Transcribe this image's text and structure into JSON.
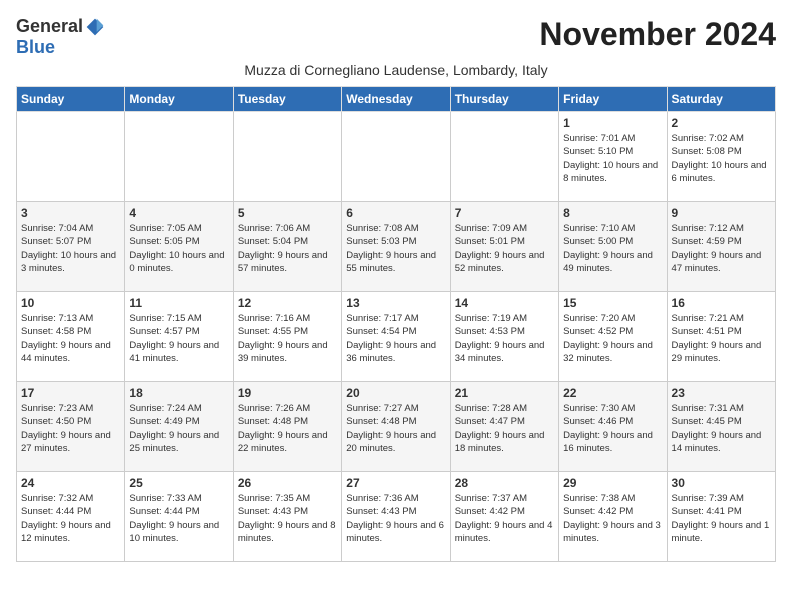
{
  "logo": {
    "general": "General",
    "blue": "Blue"
  },
  "title": "November 2024",
  "subtitle": "Muzza di Cornegliano Laudense, Lombardy, Italy",
  "days_of_week": [
    "Sunday",
    "Monday",
    "Tuesday",
    "Wednesday",
    "Thursday",
    "Friday",
    "Saturday"
  ],
  "weeks": [
    [
      {
        "day": "",
        "info": ""
      },
      {
        "day": "",
        "info": ""
      },
      {
        "day": "",
        "info": ""
      },
      {
        "day": "",
        "info": ""
      },
      {
        "day": "",
        "info": ""
      },
      {
        "day": "1",
        "info": "Sunrise: 7:01 AM\nSunset: 5:10 PM\nDaylight: 10 hours and 8 minutes."
      },
      {
        "day": "2",
        "info": "Sunrise: 7:02 AM\nSunset: 5:08 PM\nDaylight: 10 hours and 6 minutes."
      }
    ],
    [
      {
        "day": "3",
        "info": "Sunrise: 7:04 AM\nSunset: 5:07 PM\nDaylight: 10 hours and 3 minutes."
      },
      {
        "day": "4",
        "info": "Sunrise: 7:05 AM\nSunset: 5:05 PM\nDaylight: 10 hours and 0 minutes."
      },
      {
        "day": "5",
        "info": "Sunrise: 7:06 AM\nSunset: 5:04 PM\nDaylight: 9 hours and 57 minutes."
      },
      {
        "day": "6",
        "info": "Sunrise: 7:08 AM\nSunset: 5:03 PM\nDaylight: 9 hours and 55 minutes."
      },
      {
        "day": "7",
        "info": "Sunrise: 7:09 AM\nSunset: 5:01 PM\nDaylight: 9 hours and 52 minutes."
      },
      {
        "day": "8",
        "info": "Sunrise: 7:10 AM\nSunset: 5:00 PM\nDaylight: 9 hours and 49 minutes."
      },
      {
        "day": "9",
        "info": "Sunrise: 7:12 AM\nSunset: 4:59 PM\nDaylight: 9 hours and 47 minutes."
      }
    ],
    [
      {
        "day": "10",
        "info": "Sunrise: 7:13 AM\nSunset: 4:58 PM\nDaylight: 9 hours and 44 minutes."
      },
      {
        "day": "11",
        "info": "Sunrise: 7:15 AM\nSunset: 4:57 PM\nDaylight: 9 hours and 41 minutes."
      },
      {
        "day": "12",
        "info": "Sunrise: 7:16 AM\nSunset: 4:55 PM\nDaylight: 9 hours and 39 minutes."
      },
      {
        "day": "13",
        "info": "Sunrise: 7:17 AM\nSunset: 4:54 PM\nDaylight: 9 hours and 36 minutes."
      },
      {
        "day": "14",
        "info": "Sunrise: 7:19 AM\nSunset: 4:53 PM\nDaylight: 9 hours and 34 minutes."
      },
      {
        "day": "15",
        "info": "Sunrise: 7:20 AM\nSunset: 4:52 PM\nDaylight: 9 hours and 32 minutes."
      },
      {
        "day": "16",
        "info": "Sunrise: 7:21 AM\nSunset: 4:51 PM\nDaylight: 9 hours and 29 minutes."
      }
    ],
    [
      {
        "day": "17",
        "info": "Sunrise: 7:23 AM\nSunset: 4:50 PM\nDaylight: 9 hours and 27 minutes."
      },
      {
        "day": "18",
        "info": "Sunrise: 7:24 AM\nSunset: 4:49 PM\nDaylight: 9 hours and 25 minutes."
      },
      {
        "day": "19",
        "info": "Sunrise: 7:26 AM\nSunset: 4:48 PM\nDaylight: 9 hours and 22 minutes."
      },
      {
        "day": "20",
        "info": "Sunrise: 7:27 AM\nSunset: 4:48 PM\nDaylight: 9 hours and 20 minutes."
      },
      {
        "day": "21",
        "info": "Sunrise: 7:28 AM\nSunset: 4:47 PM\nDaylight: 9 hours and 18 minutes."
      },
      {
        "day": "22",
        "info": "Sunrise: 7:30 AM\nSunset: 4:46 PM\nDaylight: 9 hours and 16 minutes."
      },
      {
        "day": "23",
        "info": "Sunrise: 7:31 AM\nSunset: 4:45 PM\nDaylight: 9 hours and 14 minutes."
      }
    ],
    [
      {
        "day": "24",
        "info": "Sunrise: 7:32 AM\nSunset: 4:44 PM\nDaylight: 9 hours and 12 minutes."
      },
      {
        "day": "25",
        "info": "Sunrise: 7:33 AM\nSunset: 4:44 PM\nDaylight: 9 hours and 10 minutes."
      },
      {
        "day": "26",
        "info": "Sunrise: 7:35 AM\nSunset: 4:43 PM\nDaylight: 9 hours and 8 minutes."
      },
      {
        "day": "27",
        "info": "Sunrise: 7:36 AM\nSunset: 4:43 PM\nDaylight: 9 hours and 6 minutes."
      },
      {
        "day": "28",
        "info": "Sunrise: 7:37 AM\nSunset: 4:42 PM\nDaylight: 9 hours and 4 minutes."
      },
      {
        "day": "29",
        "info": "Sunrise: 7:38 AM\nSunset: 4:42 PM\nDaylight: 9 hours and 3 minutes."
      },
      {
        "day": "30",
        "info": "Sunrise: 7:39 AM\nSunset: 4:41 PM\nDaylight: 9 hours and 1 minute."
      }
    ]
  ]
}
